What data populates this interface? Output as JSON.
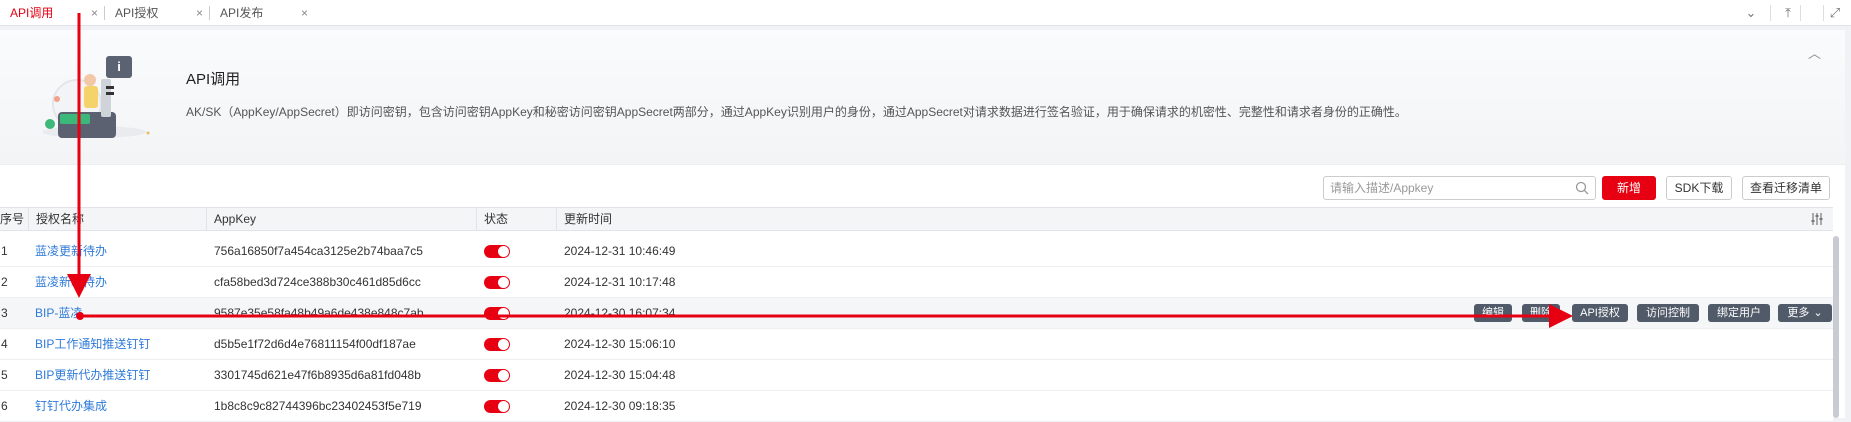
{
  "tabs": [
    {
      "label": "API调用",
      "active": true
    },
    {
      "label": "API授权",
      "active": false
    },
    {
      "label": "API发布",
      "active": false
    }
  ],
  "tab_close": "×",
  "tab_tools": {
    "dropdown": "⌄",
    "pin": "⤒",
    "fullscreen": "⤢"
  },
  "banner": {
    "title": "API调用",
    "description": "AK/SK（AppKey/AppSecret）即访问密钥，包含访问密钥AppKey和秘密访问密钥AppSecret两部分，通过AppKey识别用户的身份，通过AppSecret对请求数据进行签名验证，用于确保请求的机密性、完整性和请求者身份的正确性。",
    "illustration_badge": "i",
    "collapse": "︿"
  },
  "toolbar": {
    "search_placeholder": "请输入描述/Appkey",
    "add_label": "新增",
    "sdk_label": "SDK下载",
    "migrate_label": "查看迁移清单"
  },
  "table": {
    "columns": [
      "序号",
      "授权名称",
      "AppKey",
      "状态",
      "更新时间"
    ],
    "rows": [
      {
        "no": "1",
        "name": "蓝凌更新待办",
        "appkey": "756a16850f7a454ca3125e2b74baa7c5",
        "status_on": true,
        "time": "2024-12-31 10:46:49"
      },
      {
        "no": "2",
        "name": "蓝凌新增待办",
        "appkey": "cfa58bed3d724ce388b30c461d85d6cc",
        "status_on": true,
        "time": "2024-12-31 10:17:48"
      },
      {
        "no": "3",
        "name": "BIP-蓝凌",
        "appkey": "9587e35e58fa48b49a6de438e848c7ab",
        "status_on": true,
        "time": "2024-12-30 16:07:34"
      },
      {
        "no": "4",
        "name": "BIP工作通知推送钉钉",
        "appkey": "d5b5e1f72d6d4e76811154f00df187ae",
        "status_on": true,
        "time": "2024-12-30 15:06:10"
      },
      {
        "no": "5",
        "name": "BIP更新代办推送钉钉",
        "appkey": "3301745d621e47f6b8935d6a81fd048b",
        "status_on": true,
        "time": "2024-12-30 15:04:48"
      },
      {
        "no": "6",
        "name": "钉钉代办集成",
        "appkey": "1b8c8c9c82744396bc23402453f5e719",
        "status_on": true,
        "time": "2024-12-30 09:18:35"
      }
    ],
    "row_actions": [
      "编辑",
      "删除",
      "API授权",
      "访问控制",
      "绑定用户",
      "更多"
    ],
    "more_chevron": "⌄"
  },
  "colors": {
    "accent": "#e60012",
    "link": "#2f7bd9",
    "action_button": "#505a68"
  }
}
